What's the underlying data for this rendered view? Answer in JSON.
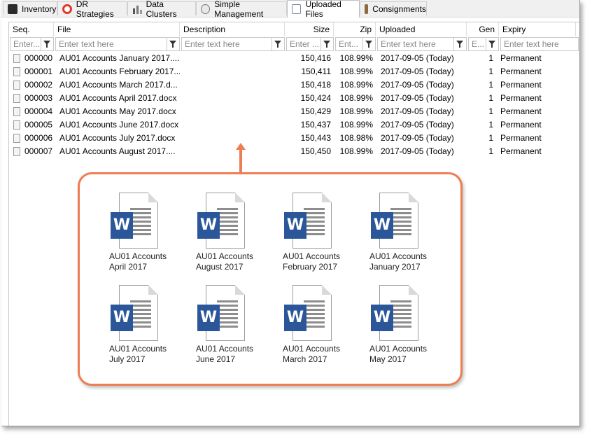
{
  "tabs": [
    {
      "label": "Inventory",
      "icon": "inventory-icon"
    },
    {
      "label": "DR Strategies",
      "icon": "lifebuoy-icon"
    },
    {
      "label": "Data Clusters",
      "icon": "bar-chart-icon"
    },
    {
      "label": "Simple Management",
      "icon": "gear-icon"
    },
    {
      "label": "Uploaded Files",
      "icon": "window-icon",
      "active": true
    },
    {
      "label": "Consignments",
      "icon": "box-icon"
    }
  ],
  "columns": [
    {
      "label": "Seq.",
      "filter_placeholder": "Enter..."
    },
    {
      "label": "File",
      "filter_placeholder": "Enter text here"
    },
    {
      "label": "Description",
      "filter_placeholder": "Enter text here"
    },
    {
      "label": "Size",
      "filter_placeholder": "Enter ..."
    },
    {
      "label": "Zip",
      "filter_placeholder": "Ent..."
    },
    {
      "label": "Uploaded",
      "filter_placeholder": "Enter text here"
    },
    {
      "label": "Gen",
      "filter_placeholder": "E..."
    },
    {
      "label": "Expiry",
      "filter_placeholder": "Enter text here"
    }
  ],
  "rows": [
    {
      "seq": "000000",
      "file": "AU01 Accounts January 2017....",
      "description": "",
      "size": "150,416",
      "zip": "108.99%",
      "uploaded": "2017-09-05 (Today)",
      "gen": "1",
      "expiry": "Permanent"
    },
    {
      "seq": "000001",
      "file": "AU01 Accounts February 2017....",
      "description": "",
      "size": "150,411",
      "zip": "108.99%",
      "uploaded": "2017-09-05 (Today)",
      "gen": "1",
      "expiry": "Permanent"
    },
    {
      "seq": "000002",
      "file": "AU01 Accounts March 2017.d...",
      "description": "",
      "size": "150,418",
      "zip": "108.99%",
      "uploaded": "2017-09-05 (Today)",
      "gen": "1",
      "expiry": "Permanent"
    },
    {
      "seq": "000003",
      "file": "AU01 Accounts April 2017.docx",
      "description": "",
      "size": "150,424",
      "zip": "108.99%",
      "uploaded": "2017-09-05 (Today)",
      "gen": "1",
      "expiry": "Permanent"
    },
    {
      "seq": "000004",
      "file": "AU01 Accounts May 2017.docx",
      "description": "",
      "size": "150,429",
      "zip": "108.99%",
      "uploaded": "2017-09-05 (Today)",
      "gen": "1",
      "expiry": "Permanent"
    },
    {
      "seq": "000005",
      "file": "AU01 Accounts June 2017.docx",
      "description": "",
      "size": "150,437",
      "zip": "108.99%",
      "uploaded": "2017-09-05 (Today)",
      "gen": "1",
      "expiry": "Permanent"
    },
    {
      "seq": "000006",
      "file": "AU01 Accounts July 2017.docx",
      "description": "",
      "size": "150,443",
      "zip": "108.98%",
      "uploaded": "2017-09-05 (Today)",
      "gen": "1",
      "expiry": "Permanent"
    },
    {
      "seq": "000007",
      "file": "AU01 Accounts August 2017....",
      "description": "",
      "size": "150,450",
      "zip": "108.99%",
      "uploaded": "2017-09-05 (Today)",
      "gen": "1",
      "expiry": "Permanent"
    }
  ],
  "callout": {
    "accent_color": "#ee7d53",
    "files": [
      {
        "line1": "AU01 Accounts",
        "line2": "April 2017"
      },
      {
        "line1": "AU01 Accounts",
        "line2": "August 2017"
      },
      {
        "line1": "AU01 Accounts",
        "line2": "February 2017"
      },
      {
        "line1": "AU01 Accounts",
        "line2": "January 2017"
      },
      {
        "line1": "AU01 Accounts",
        "line2": "July 2017"
      },
      {
        "line1": "AU01 Accounts",
        "line2": "June 2017"
      },
      {
        "line1": "AU01 Accounts",
        "line2": "March 2017"
      },
      {
        "line1": "AU01 Accounts",
        "line2": "May 2017"
      }
    ],
    "file_icon": "word-document-icon",
    "file_icon_letter": "W"
  }
}
